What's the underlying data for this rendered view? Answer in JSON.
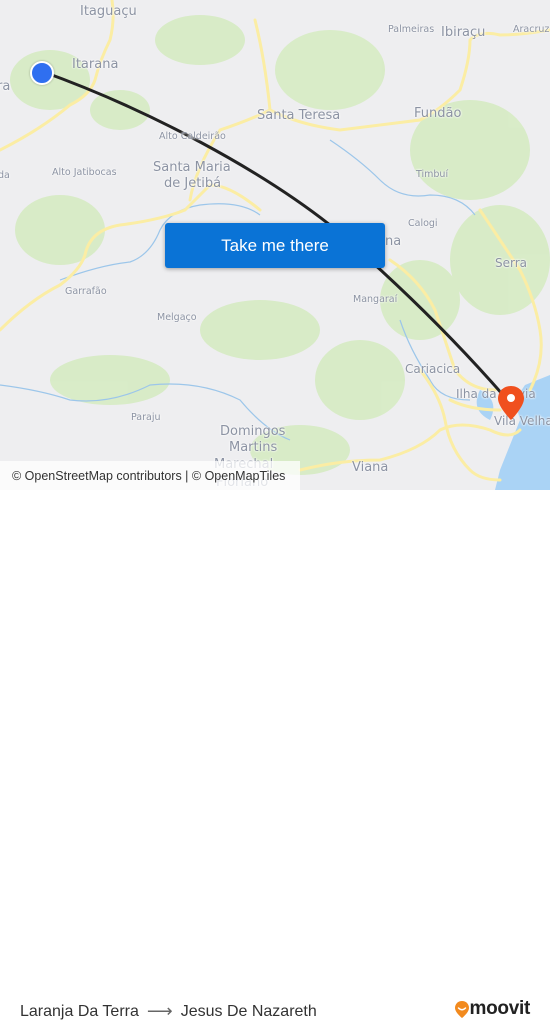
{
  "map": {
    "place_labels": [
      {
        "id": "itaguacu",
        "text": "Itaguaçu"
      },
      {
        "id": "itarana",
        "text": "Itarana"
      },
      {
        "id": "ra-partial",
        "text": "ra"
      },
      {
        "id": "alto-caldeirao",
        "text": "Alto Caldeirão"
      },
      {
        "id": "santa-maria",
        "text": "Santa Maria"
      },
      {
        "id": "de-jetiba",
        "text": "de Jetibá"
      },
      {
        "id": "alto-jatibocas",
        "text": "Alto Jatibocas"
      },
      {
        "id": "da-partial",
        "text": "da"
      },
      {
        "id": "palmeiras",
        "text": "Palmeiras"
      },
      {
        "id": "ibiracu",
        "text": "Ibiraçu"
      },
      {
        "id": "aracruz",
        "text": "Aracruz"
      },
      {
        "id": "santa-teresa",
        "text": "Santa Teresa"
      },
      {
        "id": "fundao",
        "text": "Fundão"
      },
      {
        "id": "timbui",
        "text": "Timbuí"
      },
      {
        "id": "calogi",
        "text": "Calogi"
      },
      {
        "id": "na-partial",
        "text": "na"
      },
      {
        "id": "serra",
        "text": "Serra"
      },
      {
        "id": "garrafao",
        "text": "Garrafão"
      },
      {
        "id": "melgaco",
        "text": "Melgaço"
      },
      {
        "id": "mangarai",
        "text": "Mangaraí"
      },
      {
        "id": "cariacica",
        "text": "Cariacica"
      },
      {
        "id": "ilha",
        "text": "Ilha da Pólvia"
      },
      {
        "id": "vila-velha",
        "text": "Vila Velha"
      },
      {
        "id": "paraju",
        "text": "Paraju"
      },
      {
        "id": "domingos",
        "text": "Domingos"
      },
      {
        "id": "martins",
        "text": "Martins"
      },
      {
        "id": "marechal",
        "text": "Marechal"
      },
      {
        "id": "floriano",
        "text": "Floriano"
      },
      {
        "id": "viana",
        "text": "Viana"
      }
    ],
    "take_me_there": "Take me there",
    "attribution": "© OpenStreetMap contributors | © OpenMapTiles",
    "colors": {
      "route_line": "#222222",
      "origin_marker": "#2f6ff0",
      "destination_marker": "#f0501e",
      "button": "#0a73d6",
      "water": "#aad3f5",
      "road": "#fbeda4",
      "forest": "#cfe8b8"
    }
  },
  "footer": {
    "origin": "Laranja Da Terra",
    "arrow": "⟶",
    "destination": "Jesus De Nazareth",
    "brand": "moovit"
  }
}
